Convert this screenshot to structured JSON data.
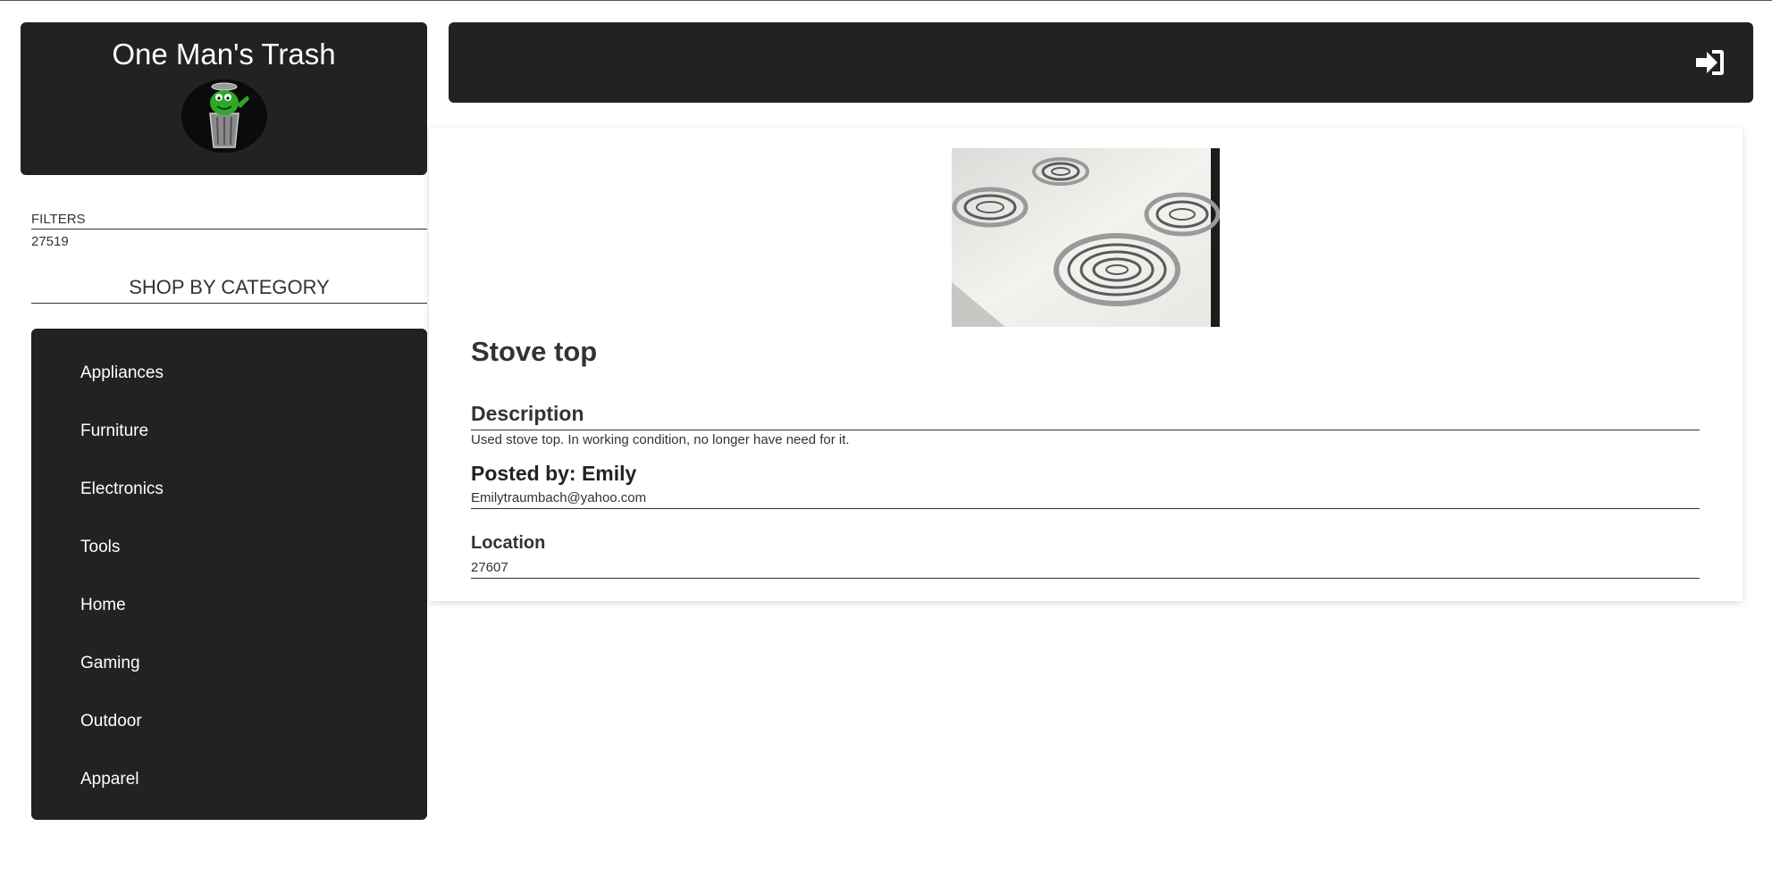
{
  "brand": {
    "title": "One Man's Trash"
  },
  "header": {
    "login_icon": "sign-in-icon"
  },
  "filters": {
    "label": "FILTERS",
    "zip": "27519"
  },
  "categories": {
    "heading": "SHOP BY CATEGORY",
    "items": [
      "Appliances",
      "Furniture",
      "Electronics",
      "Tools",
      "Home",
      "Gaming",
      "Outdoor",
      "Apparel"
    ]
  },
  "listing": {
    "title": "Stove top",
    "description_heading": "Description",
    "description": "Used stove top. In working condition, no longer have need for it.",
    "posted_by": "Posted by: Emily",
    "email": "Emilytraumbach@yahoo.com",
    "location_heading": "Location",
    "location": "27607"
  }
}
